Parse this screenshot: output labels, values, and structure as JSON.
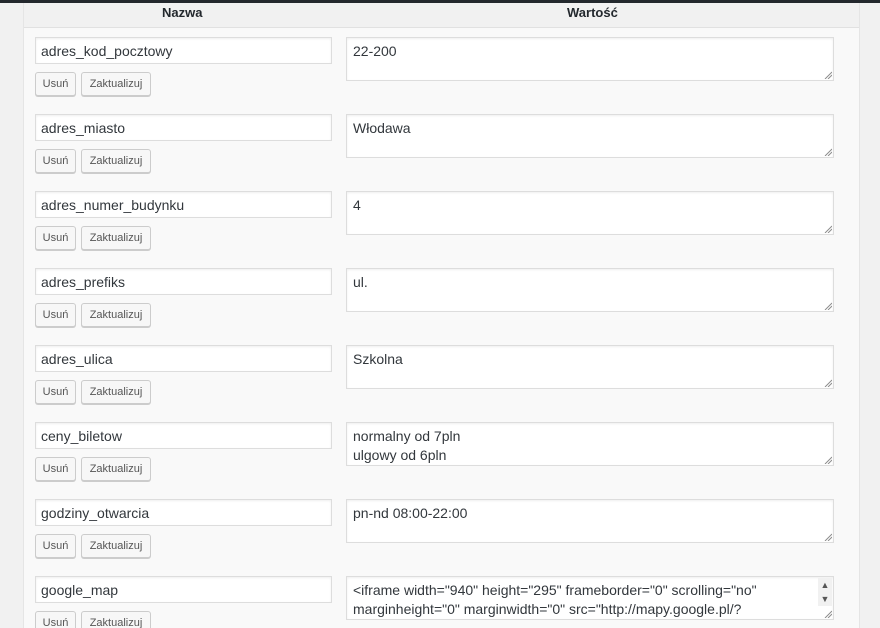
{
  "header": {
    "name_label": "Nazwa",
    "value_label": "Wartość"
  },
  "buttons": {
    "delete_label": "Usuń",
    "update_label": "Zaktualizuj"
  },
  "rows": [
    {
      "name": "adres_kod_pocztowy",
      "value_lines": [
        "22-200"
      ]
    },
    {
      "name": "adres_miasto",
      "value_lines": [
        "Włodawa"
      ]
    },
    {
      "name": "adres_numer_budynku",
      "value_lines": [
        "4"
      ]
    },
    {
      "name": "adres_prefiks",
      "value_lines": [
        "ul."
      ]
    },
    {
      "name": "adres_ulica",
      "value_lines": [
        "Szkolna"
      ]
    },
    {
      "name": "ceny_biletow",
      "value_lines": [
        "normalny od 7pln",
        "ulgowy od 6pln"
      ]
    },
    {
      "name": "godziny_otwarcia",
      "value_lines": [
        "pn-nd 08:00-22:00"
      ]
    },
    {
      "name": "google_map",
      "value_lines": [
        "<iframe width=\"940\" height=\"295\" frameborder=\"0\" scrolling=\"no\"",
        "marginheight=\"0\" marginwidth=\"0\" src=\"http://mapy.google.pl/?"
      ]
    }
  ],
  "icons": {
    "resize": "resize-grip-icon",
    "scroll_up": "scroll-up-arrow-icon",
    "scroll_down": "scroll-down-arrow-icon"
  }
}
